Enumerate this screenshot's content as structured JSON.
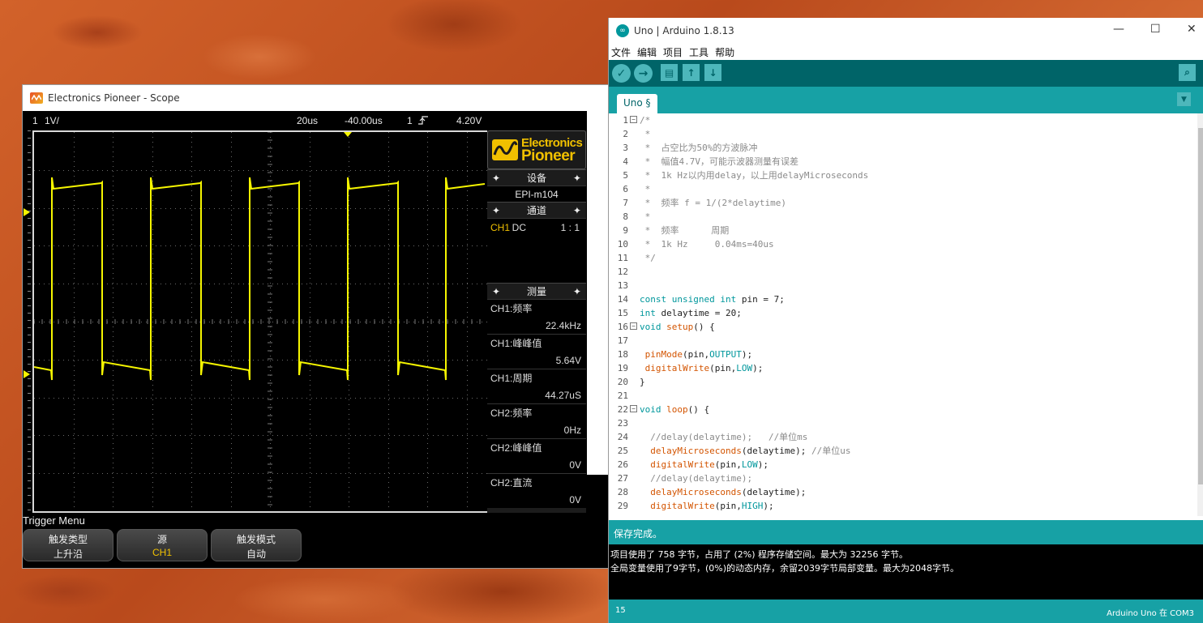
{
  "scope": {
    "title": "Electronics Pioneer - Scope",
    "topbar": {
      "ch": "1",
      "vdiv": "1V/",
      "timebase": "20us",
      "offset": "-40.00us",
      "trig_ch": "1",
      "trig_level": "4.20V"
    },
    "brand": {
      "line1": "Electronics",
      "line2": "Pioneer"
    },
    "device_head": "设备",
    "device_name": "EPI-m104",
    "channel_head": "通道",
    "channel": {
      "name": "CH1",
      "coupling": "DC",
      "probe": "1 : 1"
    },
    "measure_head": "测量",
    "measurements": [
      {
        "label": "CH1:频率",
        "value": "22.4kHz"
      },
      {
        "label": "CH1:峰峰值",
        "value": "5.64V"
      },
      {
        "label": "CH1:周期",
        "value": "44.27uS"
      },
      {
        "label": "CH2:频率",
        "value": "0Hz"
      },
      {
        "label": "CH2:峰峰值",
        "value": "0V"
      },
      {
        "label": "CH2:直流",
        "value": "0V"
      }
    ],
    "trigger_menu": {
      "title": "Trigger Menu",
      "buttons": [
        {
          "label": "触发类型",
          "value": "上升沿"
        },
        {
          "label": "源",
          "value": "CH1"
        },
        {
          "label": "触发模式",
          "value": "自动"
        }
      ]
    },
    "colors": {
      "trace": "#f5f500",
      "accent": "#f0c000"
    }
  },
  "arduino": {
    "title": "Uno | Arduino 1.8.13",
    "icon": "∞",
    "menu": [
      "文件",
      "编辑",
      "项目",
      "工具",
      "帮助"
    ],
    "toolbar": {
      "verify": "✓",
      "upload": "→",
      "new": "▤",
      "open": "↑",
      "save": "↓",
      "serial_monitor": "⌕"
    },
    "tab": "Uno §",
    "tab_menu": "▼",
    "status": "保存完成。",
    "console": [
      "项目使用了 758 字节，占用了 (2%) 程序存储空间。最大为 32256 字节。",
      "全局变量使用了9字节，(0%)的动态内存，余留2039字节局部变量。最大为2048字节。"
    ],
    "footer_line": "15",
    "footer_board": "Arduino Uno 在 COM3",
    "code": [
      {
        "n": "1",
        "fold": "⊟",
        "t": "/*"
      },
      {
        "n": "2",
        "t": " *"
      },
      {
        "n": "3",
        "t": " *  占空比为50%的方波脉冲"
      },
      {
        "n": "4",
        "t": " *  幅值4.7V，可能示波器测量有误差"
      },
      {
        "n": "5",
        "t": " *  1k Hz以内用delay，以上用delayMicroseconds"
      },
      {
        "n": "6",
        "t": " *"
      },
      {
        "n": "7",
        "t": " *  频率 f = 1/(2*delaytime)"
      },
      {
        "n": "8",
        "t": " *"
      },
      {
        "n": "9",
        "t": " *  频率      周期"
      },
      {
        "n": "10",
        "t": " *  1k Hz     0.04ms=40us"
      },
      {
        "n": "11",
        "t": " */"
      },
      {
        "n": "12",
        "t": ""
      },
      {
        "n": "13",
        "t": ""
      },
      {
        "n": "14",
        "t": "const unsigned int pin = 7;"
      },
      {
        "n": "15",
        "t": "int delaytime = 20;"
      },
      {
        "n": "16",
        "fold": "⊟",
        "t": "void setup() {"
      },
      {
        "n": "17",
        "t": ""
      },
      {
        "n": "18",
        "t": " pinMode(pin,OUTPUT);"
      },
      {
        "n": "19",
        "t": " digitalWrite(pin,LOW);"
      },
      {
        "n": "20",
        "t": "}"
      },
      {
        "n": "21",
        "t": ""
      },
      {
        "n": "22",
        "fold": "⊟",
        "t": "void loop() {"
      },
      {
        "n": "23",
        "t": ""
      },
      {
        "n": "24",
        "t": "  //delay(delaytime);   //单位ms"
      },
      {
        "n": "25",
        "t": "  delayMicroseconds(delaytime); //单位us"
      },
      {
        "n": "26",
        "t": "  digitalWrite(pin,LOW);"
      },
      {
        "n": "27",
        "t": "  //delay(delaytime);"
      },
      {
        "n": "28",
        "t": "  delayMicroseconds(delaytime);"
      },
      {
        "n": "29",
        "t": "  digitalWrite(pin,HIGH);"
      }
    ]
  }
}
